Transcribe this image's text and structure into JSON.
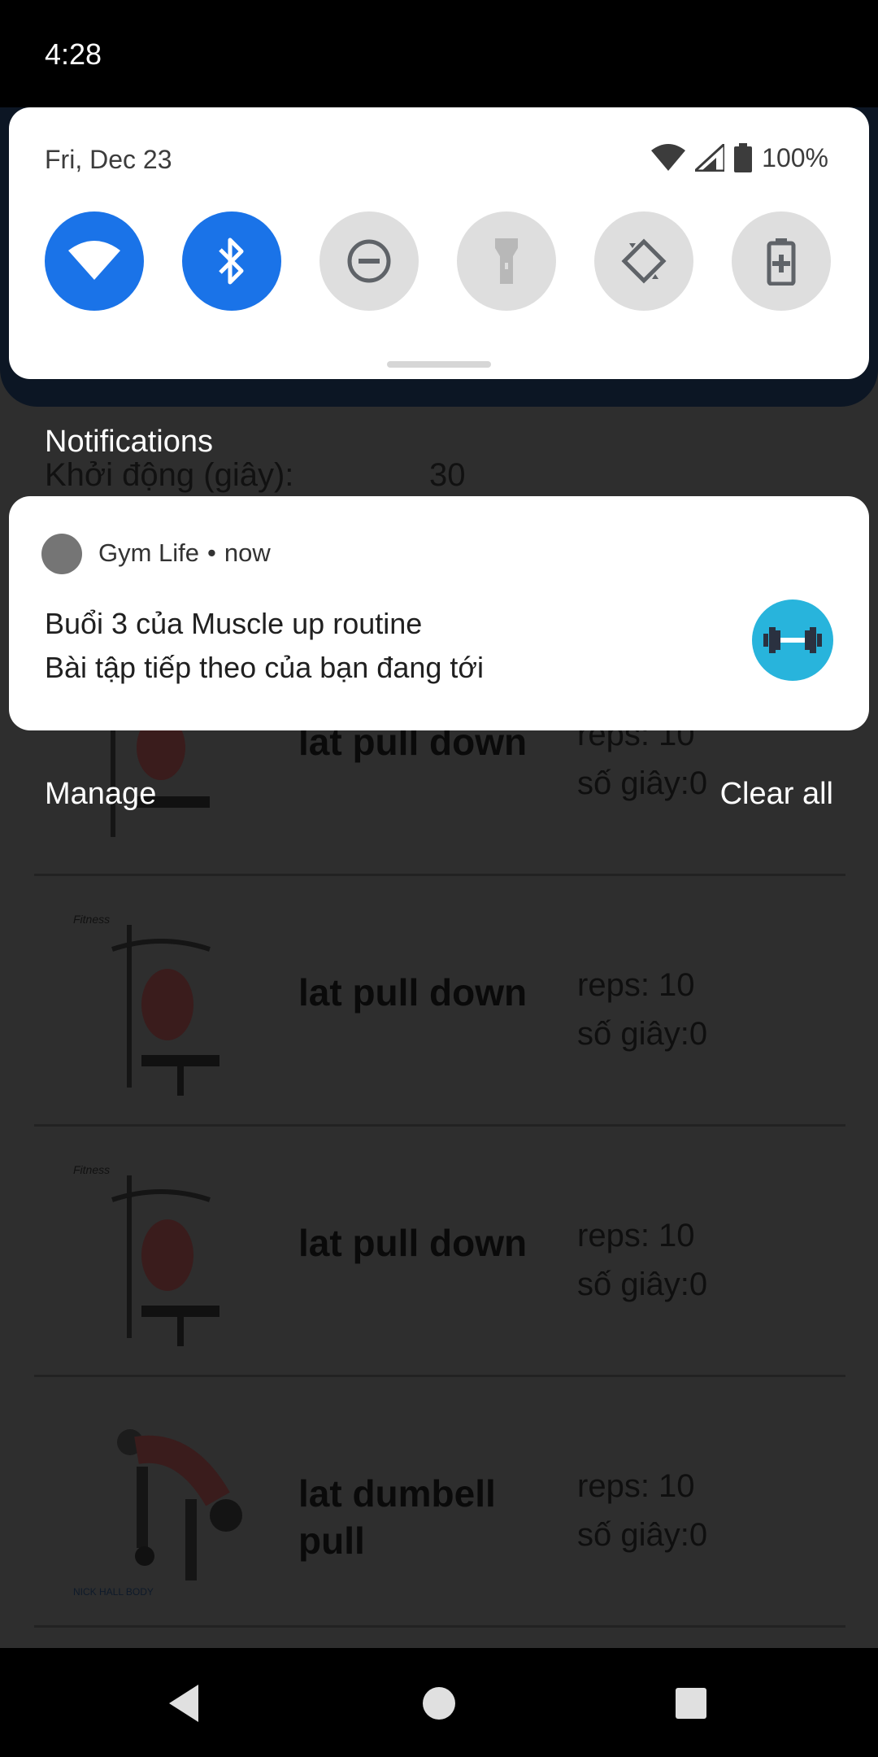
{
  "status_bar": {
    "time": "4:28"
  },
  "quick_settings": {
    "date": "Fri, Dec 23",
    "battery": "100%",
    "tiles": [
      {
        "icon": "wifi-icon",
        "active": true
      },
      {
        "icon": "bluetooth-icon",
        "active": true
      },
      {
        "icon": "do-not-disturb-icon",
        "active": false
      },
      {
        "icon": "flashlight-icon",
        "active": false
      },
      {
        "icon": "auto-rotate-icon",
        "active": false
      },
      {
        "icon": "battery-saver-icon",
        "active": false
      }
    ]
  },
  "notifications": {
    "header": "Notifications",
    "manage": "Manage",
    "clear_all": "Clear all",
    "items": [
      {
        "app": "Gym Life",
        "separator": "•",
        "time": "now",
        "title": "Buổi 3 của Muscle up routine",
        "text": "Bài tập tiếp theo của bạn đang tới",
        "avatar_color": "#28b4dc"
      }
    ]
  },
  "background_app": {
    "warmup_label": "Khởi động (giây):",
    "warmup_value": "30",
    "exercises": [
      {
        "name": "lat pull down",
        "reps": "reps: 10",
        "seconds": "số giây:0"
      },
      {
        "name": "lat pull down",
        "reps": "reps: 10",
        "seconds": "số giây:0"
      },
      {
        "name": "lat pull down",
        "reps": "reps: 10",
        "seconds": "số giây:0"
      },
      {
        "name": "lat dumbell pull",
        "reps": "reps: 10",
        "seconds": "số giây:0"
      }
    ]
  },
  "colors": {
    "accent": "#1a73e8",
    "scrim": "#2e2e2e",
    "avatar": "#28b4dc"
  }
}
